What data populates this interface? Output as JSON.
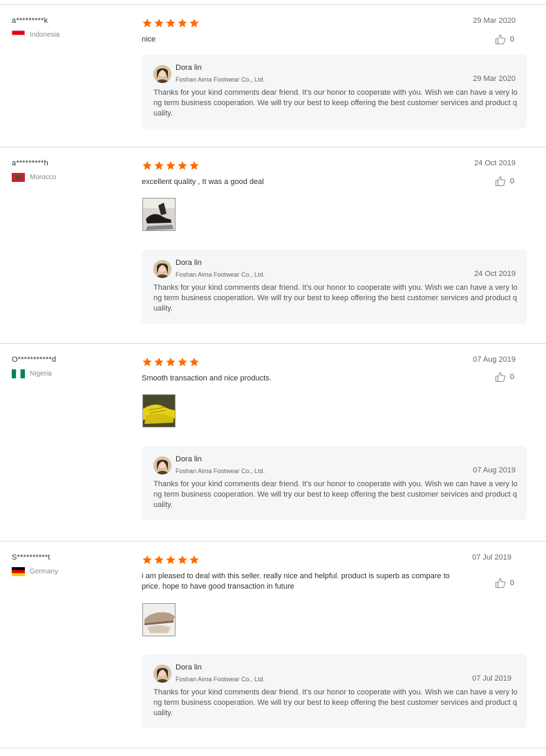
{
  "reviews": [
    {
      "user": "a*********k",
      "country": "Indonesia",
      "flag": "indonesia",
      "rating": 5,
      "date": "29 Mar 2020",
      "comment": "nice",
      "likes": "0",
      "has_image": false,
      "image_icon": "",
      "reply": {
        "seller": "Dora lin",
        "company": "Foshan Aima Footwear Co., Ltd.",
        "date": "29 Mar 2020",
        "text": "Thanks for your kind comments dear friend. It's our honor to cooperate with you. Wish we can have a very long term business cooperation. We will try our best to keep offering the best customer services and product quality."
      }
    },
    {
      "user": "a*********h",
      "country": "Morocco",
      "flag": "morocco",
      "rating": 5,
      "date": "24 Oct 2019",
      "comment": "excellent quality , It was a good deal",
      "likes": "0",
      "has_image": true,
      "image_icon": "black-shoes-photo",
      "reply": {
        "seller": "Dora lin",
        "company": "Foshan Aima Footwear Co., Ltd.",
        "date": "24 Oct 2019",
        "text": "Thanks for your kind comments dear friend. It's our honor to cooperate with you. Wish we can have a very long term business cooperation. We will try our best to keep offering the best customer services and product quality."
      }
    },
    {
      "user": "O***********d",
      "country": "Nigeria",
      "flag": "nigeria",
      "rating": 5,
      "date": "07 Aug 2019",
      "comment": "Smooth transaction and nice products.",
      "likes": "0",
      "has_image": true,
      "image_icon": "yellow-sneakers-photo",
      "reply": {
        "seller": "Dora lin",
        "company": "Foshan Aima Footwear Co., Ltd.",
        "date": "07 Aug 2019",
        "text": "Thanks for your kind comments dear friend. It's our honor to cooperate with you. Wish we can have a very long term business cooperation. We will try our best to keep offering the best customer services and product quality."
      }
    },
    {
      "user": "S**********t",
      "country": "Germany",
      "flag": "germany",
      "rating": 5,
      "date": "07 Jul 2019",
      "comment": "i am pleased to deal with this seller. really nice and helpful. product is superb as compare to price. hope to have good transaction in future",
      "likes": "0",
      "has_image": true,
      "image_icon": "beige-shoe-photo",
      "reply": {
        "seller": "Dora lin",
        "company": "Foshan Aima Footwear Co., Ltd.",
        "date": "07 Jul 2019",
        "text": "Thanks for your kind comments dear friend. It's our honor to cooperate with you. Wish we can have a very long term business cooperation. We will try our best to keep offering the best customer services and product quality."
      }
    }
  ],
  "colors": {
    "star": "#ff6a00",
    "reply_bg": "#f5f6f7",
    "divider": "#dcdcdc"
  }
}
